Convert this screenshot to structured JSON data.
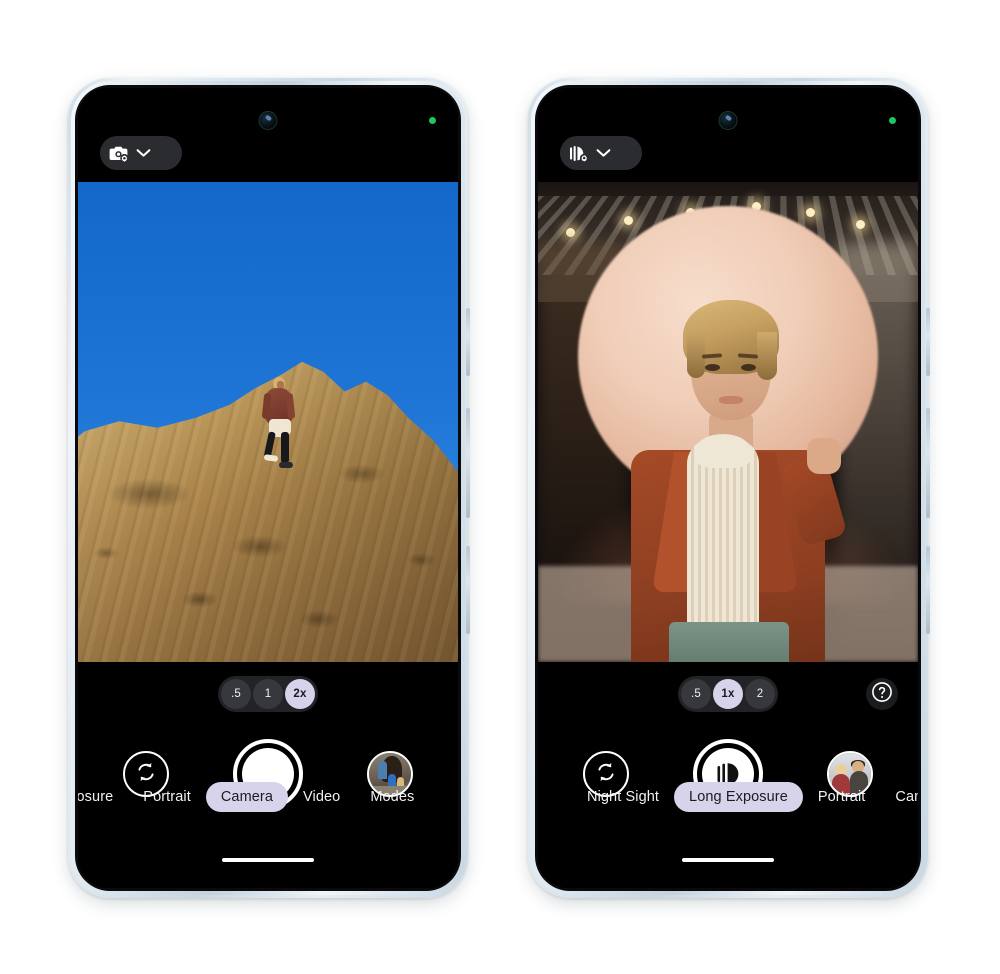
{
  "page": {
    "background": "#ffffff",
    "accent_selected": "#d7d3ea",
    "dark_surface": "#000000",
    "pill_surface": "#2b2c2f",
    "green_indicator": "#22c55e"
  },
  "phones": [
    {
      "id": "left",
      "name": "camera-phone-left",
      "status": {
        "camera_indicator_icon": "front-camera-lens",
        "privacy_dot_icon": "green-privacy-dot"
      },
      "settings_pill": {
        "icon": "camera-settings-icon",
        "chevron_icon": "chevron-down-icon"
      },
      "viewfinder": {
        "scene": "hiker-standing-on-rocky-summit-against-blue-sky"
      },
      "zoom": {
        "options": [
          {
            "label": ".5",
            "selected": false
          },
          {
            "label": "1",
            "selected": false
          },
          {
            "label": "2x",
            "selected": true
          }
        ]
      },
      "help_button": {
        "visible": false,
        "icon": "help-circle-icon",
        "label": "?"
      },
      "actions": {
        "flip_camera_icon": "flip-camera-icon",
        "shutter_icon": "shutter-photo-icon",
        "gallery_thumbnail": "gallery-thumbnail-hikers-in-cave"
      },
      "modes": [
        {
          "label": "xposure",
          "selected": false
        },
        {
          "label": "Portrait",
          "selected": false
        },
        {
          "label": "Camera",
          "selected": true
        },
        {
          "label": "Video",
          "selected": false
        },
        {
          "label": "Modes",
          "selected": false
        }
      ]
    },
    {
      "id": "right",
      "name": "camera-phone-right",
      "status": {
        "camera_indicator_icon": "front-camera-lens",
        "privacy_dot_icon": "green-privacy-dot"
      },
      "settings_pill": {
        "icon": "long-exposure-settings-icon",
        "chevron_icon": "chevron-down-icon"
      },
      "viewfinder": {
        "scene": "portrait-of-person-with-peach-balloon-at-night"
      },
      "zoom": {
        "options": [
          {
            "label": ".5",
            "selected": false
          },
          {
            "label": "1x",
            "selected": true
          },
          {
            "label": "2",
            "selected": false
          }
        ]
      },
      "help_button": {
        "visible": true,
        "icon": "help-circle-icon",
        "label": "?"
      },
      "actions": {
        "flip_camera_icon": "flip-camera-icon",
        "shutter_icon": "shutter-long-exposure-icon",
        "gallery_thumbnail": "gallery-thumbnail-couple-portrait"
      },
      "modes": [
        {
          "label": "Night Sight",
          "selected": false
        },
        {
          "label": "Long Exposure",
          "selected": true
        },
        {
          "label": "Portrait",
          "selected": false
        },
        {
          "label": "Cam",
          "selected": false
        }
      ]
    }
  ]
}
